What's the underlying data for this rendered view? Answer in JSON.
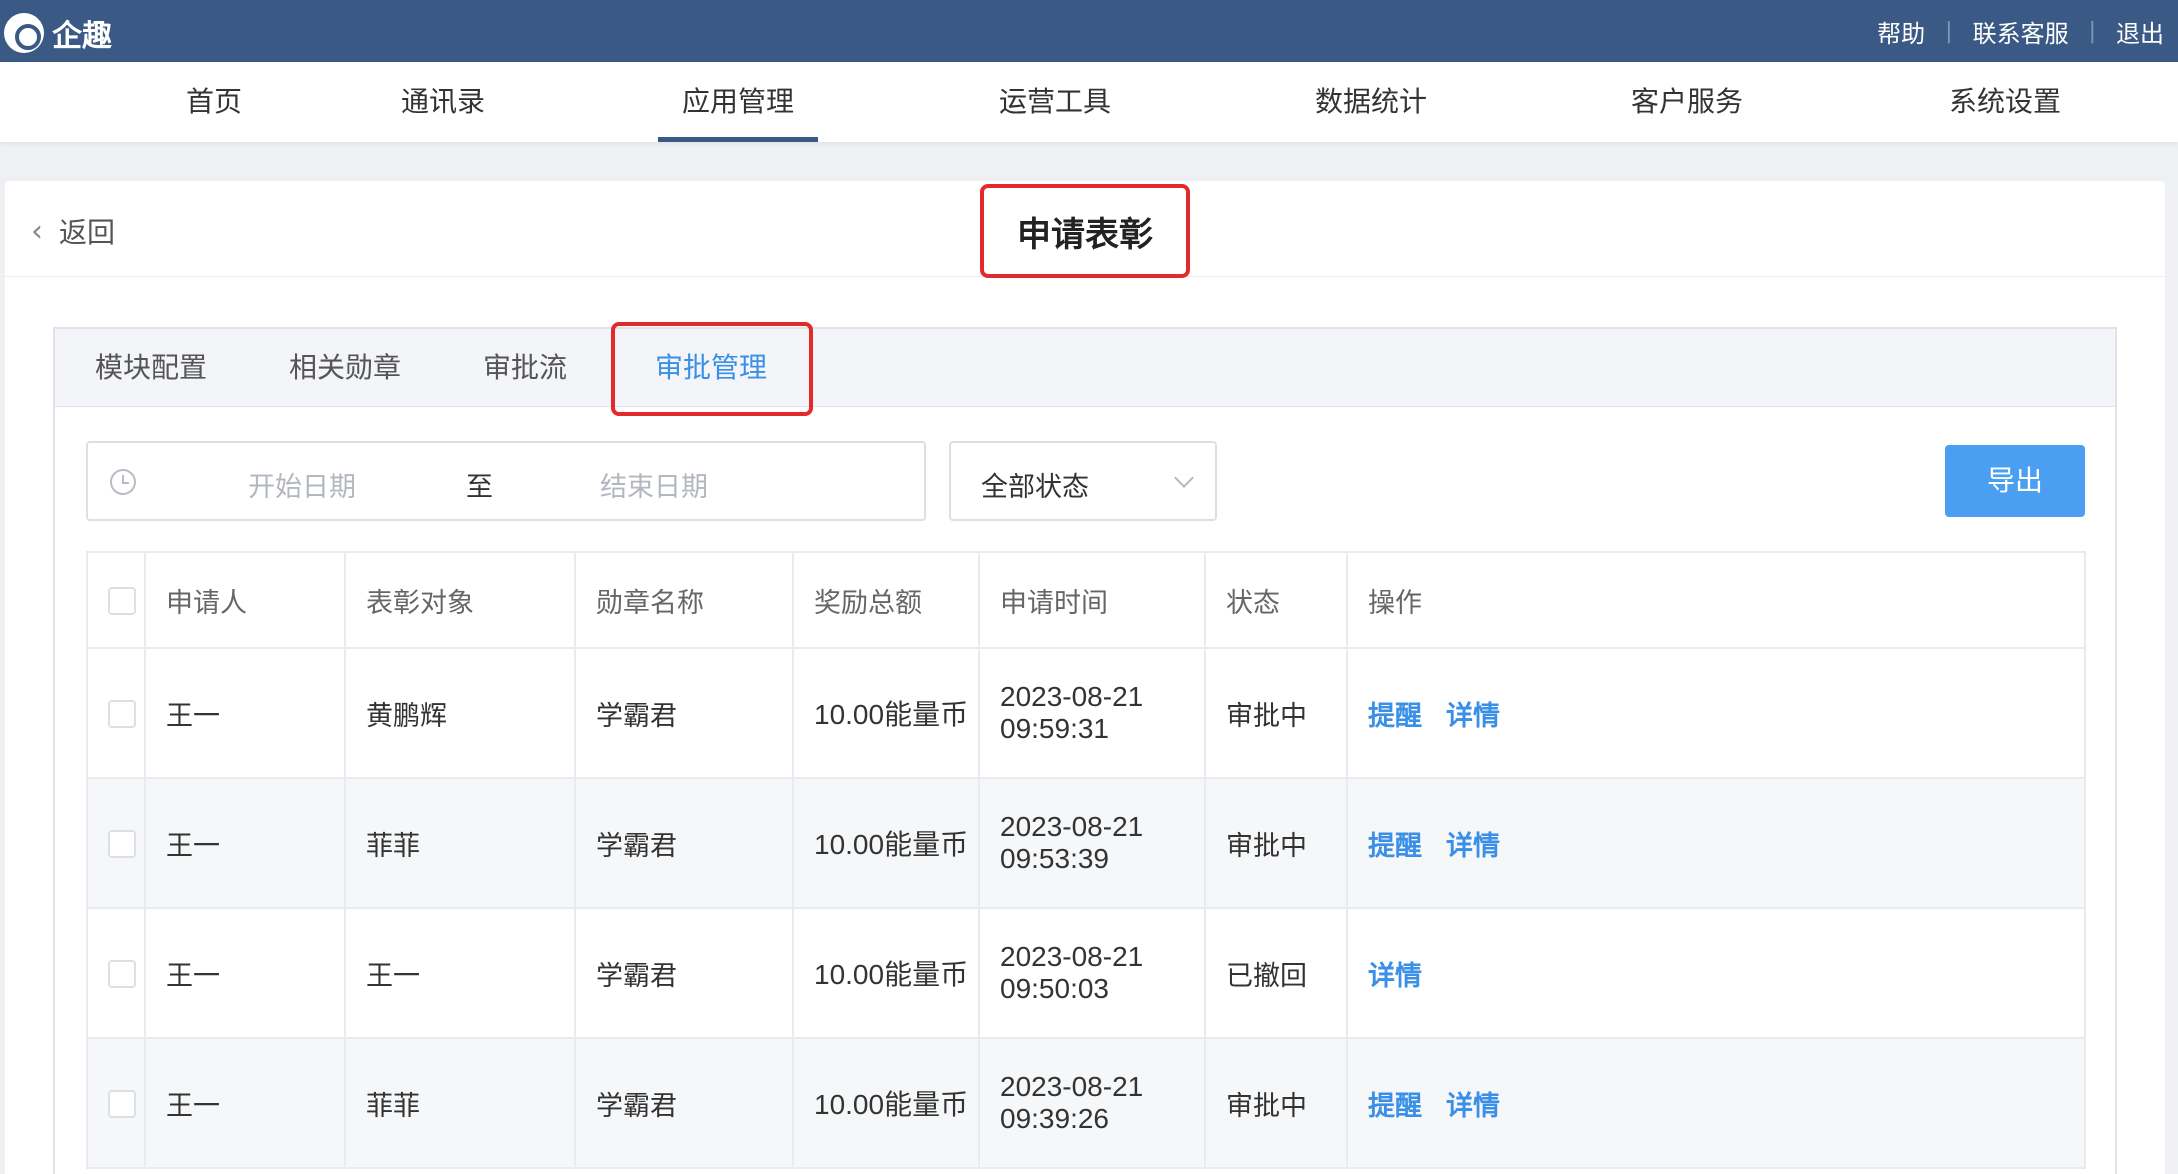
{
  "app": {
    "name": "企趣"
  },
  "top_links": [
    "帮助",
    "联系客服",
    "退出"
  ],
  "nav": [
    "首页",
    "通讯录",
    "应用管理",
    "运营工具",
    "数据统计",
    "客户服务",
    "系统设置"
  ],
  "nav_active": "应用管理",
  "header": {
    "back_label": "返回",
    "title": "申请表彰"
  },
  "tabs": [
    "模块配置",
    "相关勋章",
    "审批流",
    "审批管理"
  ],
  "filters": {
    "date_start_placeholder": "开始日期",
    "date_separator": "至",
    "date_end_placeholder": "结束日期",
    "status_value": "全部状态",
    "export_label": "导出"
  },
  "table": {
    "headers": [
      "申请人",
      "表彰对象",
      "勋章名称",
      "奖励总额",
      "申请时间",
      "状态",
      "操作"
    ],
    "rows": [
      {
        "applicant": "王一",
        "target": "黄鹏辉",
        "medal": "学霸君",
        "amount": "10.00能量币",
        "time": "2023-08-21 09:59:31",
        "status": "审批中",
        "actions": [
          "提醒",
          "详情"
        ]
      },
      {
        "applicant": "王一",
        "target": "菲菲",
        "medal": "学霸君",
        "amount": "10.00能量币",
        "time": "2023-08-21 09:53:39",
        "status": "审批中",
        "actions": [
          "提醒",
          "详情"
        ]
      },
      {
        "applicant": "王一",
        "target": "王一",
        "medal": "学霸君",
        "amount": "10.00能量币",
        "time": "2023-08-21 09:50:03",
        "status": "已撤回",
        "actions": [
          "详情"
        ]
      },
      {
        "applicant": "王一",
        "target": "菲菲",
        "medal": "学霸君",
        "amount": "10.00能量币",
        "time": "2023-08-21 09:39:26",
        "status": "审批中",
        "actions": [
          "提醒",
          "详情"
        ]
      }
    ]
  },
  "colors": {
    "topbar": "#3a5a85",
    "accent": "#3a8fe6",
    "pending": "#f0a53a",
    "recalled": "#b3b7bf",
    "highlight_box": "#e32a2a"
  }
}
